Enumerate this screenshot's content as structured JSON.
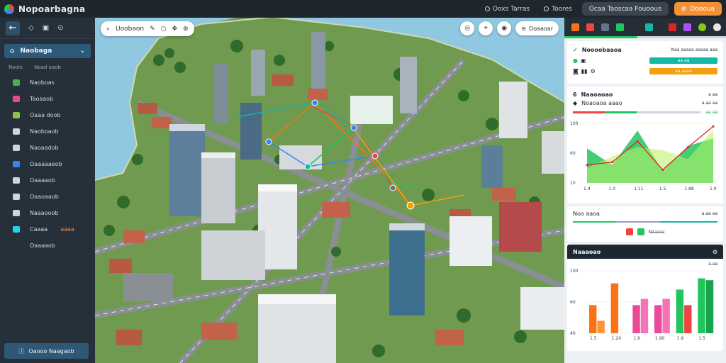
{
  "app": {
    "title": "Nopoarbagna",
    "top_links": [
      "Ooxs Tarras",
      "Toores"
    ],
    "top_pill": "Ocaa Taoscaa Fouoous",
    "top_action": "Doooua"
  },
  "sidebar": {
    "dropdown_label": "Naobaga",
    "sub_labels": [
      "Noole",
      "Noad aaob"
    ],
    "items": [
      {
        "label": "Naoboas",
        "icon": "building-icon",
        "color": "#4caf50"
      },
      {
        "label": "Taoaaob",
        "icon": "road-icon",
        "color": "#e94b8a"
      },
      {
        "label": "Oaaa doob",
        "icon": "chart-icon",
        "color": "#8bc34a"
      },
      {
        "label": "Naoboaob",
        "icon": "gear-icon",
        "color": "#cbd5e1"
      },
      {
        "label": "Naoaadob",
        "icon": "settings-icon",
        "color": "#cbd5e1"
      },
      {
        "label": "Oaaaaaeob",
        "icon": "truck-icon",
        "color": "#3b82f6"
      },
      {
        "label": "Oaaaaob",
        "icon": "heart-icon",
        "color": "#cbd5e1"
      },
      {
        "label": "Oaaoaaob",
        "icon": "layers-icon",
        "color": "#cbd5e1"
      },
      {
        "label": "Naaaooob",
        "icon": "sliders-icon",
        "color": "#cbd5e1"
      },
      {
        "label": "Caaaa",
        "icon": "bus-icon",
        "color": "#22d3ee",
        "badge": "aaaa"
      },
      {
        "label": "Oaaaaob",
        "icon": "none",
        "color": "#cbd5e1"
      }
    ],
    "footer_label": "Oaooo Naagaob"
  },
  "map": {
    "search_label": "Uoobaon",
    "right_pill": "Ooaaoar"
  },
  "panel": {
    "card1": {
      "title": "Noooobaaoa",
      "subtitle": "Naa aaaaa aaaaa aaa",
      "bar1_label": "aa aa",
      "bar2_label": "aa aaaa",
      "bar1_color": "#14b8a6",
      "bar2_color": "#f59e0b"
    },
    "card2": {
      "title": "Naaoaoao",
      "value1": "a aa",
      "subtitle": "Noaoaoa aaao",
      "value2": "a.aa aa",
      "value3": "aa aa"
    },
    "card3": {
      "title": "Noo aaoa",
      "value": "a.aa aa",
      "legend_label": "Naaaaa",
      "legend_colors": [
        "#ef4444",
        "#22c55e"
      ]
    },
    "card4": {
      "title": "Naaaoao",
      "value": "a.aa"
    }
  },
  "chart_data": [
    {
      "type": "area",
      "ylim": [
        0,
        100
      ],
      "yticks": [
        "100",
        "60",
        "10"
      ],
      "categories": [
        "1.4",
        "1.0",
        "1.11",
        "1.5",
        "1.88",
        "1.9"
      ],
      "series": [
        {
          "color": "#22c55e",
          "values": [
            58,
            30,
            88,
            20,
            62,
            75
          ]
        },
        {
          "color": "#bef264",
          "values": [
            25,
            45,
            60,
            55,
            40,
            90
          ]
        },
        {
          "color": "#dc2626",
          "values": [
            30,
            35,
            70,
            22,
            60,
            95
          ]
        }
      ]
    },
    {
      "type": "bar",
      "ylim": [
        0,
        100
      ],
      "yticks": [
        "100",
        "60",
        "40"
      ],
      "categories": [
        "1.5",
        "1.20",
        "1.9",
        "1.90",
        "1.9",
        "1.5"
      ],
      "series": [
        {
          "values": [
            45,
            80,
            45,
            45,
            70,
            88
          ],
          "colors": [
            "#f97316",
            "#f97316",
            "#ec4899",
            "#ec4899",
            "#22c55e",
            "#22c55e"
          ]
        },
        {
          "values": [
            20,
            0,
            55,
            55,
            45,
            85
          ],
          "colors": [
            "#fb923c",
            "#fdba74",
            "#f472b6",
            "#f472b6",
            "#ef4444",
            "#16a34a"
          ]
        }
      ]
    }
  ]
}
